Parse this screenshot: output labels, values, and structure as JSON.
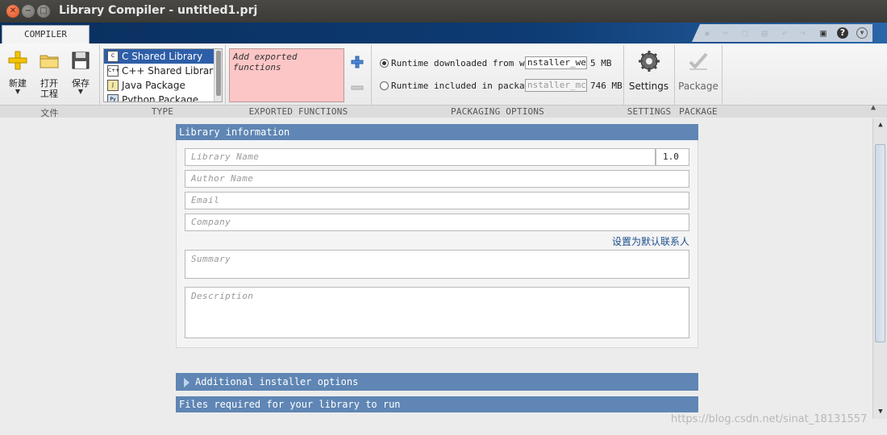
{
  "window": {
    "title": "Library Compiler - untitled1.prj",
    "controls": [
      "close-icon",
      "minimize-icon",
      "maximize-icon"
    ]
  },
  "tabs": [
    {
      "label": "COMPILER",
      "active": true
    }
  ],
  "quick_access": [
    "save-icon",
    "cut-icon",
    "copy-icon",
    "paste-icon",
    "undo-icon",
    "redo-icon",
    "window-icon",
    "help-icon",
    "dropdown-icon"
  ],
  "file_group": {
    "label": "文件",
    "new": "新建",
    "open": "打开\n工程",
    "save": "保存"
  },
  "type_group": {
    "label": "TYPE",
    "items": [
      {
        "label": "C Shared Library",
        "selected": true,
        "icon": "c-library-icon"
      },
      {
        "label": "C++ Shared Library",
        "selected": false,
        "icon": "cpp-library-icon"
      },
      {
        "label": "Java Package",
        "selected": false,
        "icon": "java-package-icon"
      },
      {
        "label": "Python Package",
        "selected": false,
        "icon": "python-package-icon"
      }
    ]
  },
  "exported_group": {
    "label": "EXPORTED FUNCTIONS",
    "placeholder": "Add exported functions"
  },
  "packaging_group": {
    "label": "PACKAGING OPTIONS",
    "web_label": "Runtime downloaded from web",
    "web_value": "nstaller_web",
    "web_size": "5 MB",
    "pkg_label": "Runtime included in package",
    "pkg_value": "nstaller_mcr",
    "pkg_size": "746 MB",
    "selected": "web"
  },
  "settings_group": {
    "label": "SETTINGS",
    "button": "Settings"
  },
  "package_group": {
    "label": "PACKAGE",
    "button": "Package"
  },
  "library_info": {
    "header": "Library information",
    "name_placeholder": "Library Name",
    "version": "1.0",
    "author_placeholder": "Author Name",
    "email_placeholder": "Email",
    "company_placeholder": "Company",
    "default_contact_link": "设置为默认联系人",
    "summary_placeholder": "Summary",
    "description_placeholder": "Description"
  },
  "sections": {
    "additional": "Additional installer options",
    "files_required": "Files required for your library to run"
  },
  "watermark": "https://blog.csdn.net/sinat_18131557",
  "colors": {
    "accent": "#5f86b4",
    "selection": "#2d5ea8",
    "exported_bg": "#fdc6c6",
    "link": "#1d4f8e"
  }
}
